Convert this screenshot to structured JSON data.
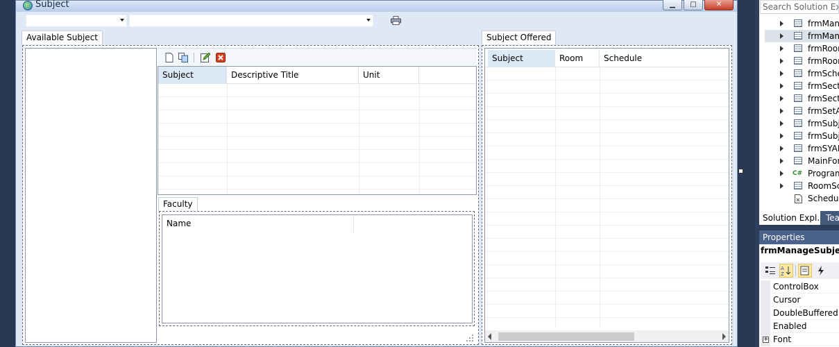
{
  "window": {
    "title": "Subject",
    "minimize_glyph": "▁",
    "maximize_glyph": "□",
    "close_glyph": "✕"
  },
  "toolstrip": {
    "combo1_value": "",
    "combo2_value": ""
  },
  "available_subject": {
    "tab_label": "Available Subject"
  },
  "subject_grid": {
    "columns": [
      "Subject",
      "Descriptive Title",
      "Unit"
    ]
  },
  "faculty": {
    "tab_label": "Faculty",
    "columns": [
      "Name"
    ]
  },
  "subject_offered": {
    "tab_label": "Subject Offered",
    "columns": [
      "Subject",
      "Room",
      "Schedule"
    ]
  },
  "solution_explorer": {
    "search_placeholder": "Search Solution Explo",
    "items": [
      {
        "label": "frmMana",
        "icon": "form-icon",
        "expandable": true
      },
      {
        "label": "frmMana",
        "icon": "form-icon",
        "expandable": true,
        "selected": true
      },
      {
        "label": "frmRoor",
        "icon": "form-icon",
        "expandable": true
      },
      {
        "label": "frmRoor",
        "icon": "form-icon",
        "expandable": true
      },
      {
        "label": "frmSche",
        "icon": "form-icon",
        "expandable": true
      },
      {
        "label": "frmSecti",
        "icon": "form-icon",
        "expandable": true
      },
      {
        "label": "frmSecti",
        "icon": "form-icon",
        "expandable": true
      },
      {
        "label": "frmSetA",
        "icon": "form-icon",
        "expandable": true
      },
      {
        "label": "frmSubje",
        "icon": "form-icon",
        "expandable": true
      },
      {
        "label": "frmSubje",
        "icon": "form-icon",
        "expandable": true
      },
      {
        "label": "frmSYAE",
        "icon": "form-icon",
        "expandable": true
      },
      {
        "label": "MainFor",
        "icon": "form-icon",
        "expandable": true
      },
      {
        "label": "Program",
        "icon": "csharp-icon",
        "expandable": true
      },
      {
        "label": "RoomSc",
        "icon": "form-icon",
        "expandable": true
      },
      {
        "label": "Schedule",
        "icon": "resx-icon",
        "expandable": false
      }
    ],
    "tabs": [
      "Solution Expl...",
      "Tea"
    ]
  },
  "properties": {
    "title": "Properties",
    "object_name": "frmManageSubject",
    "rows": [
      "ControlBox",
      "Cursor",
      "DoubleBuffered",
      "Enabled",
      "Font"
    ]
  },
  "colors": {
    "accent_selected": "#dbe9f7",
    "vs_chrome": "#293955",
    "close_red": "#c6402a"
  }
}
